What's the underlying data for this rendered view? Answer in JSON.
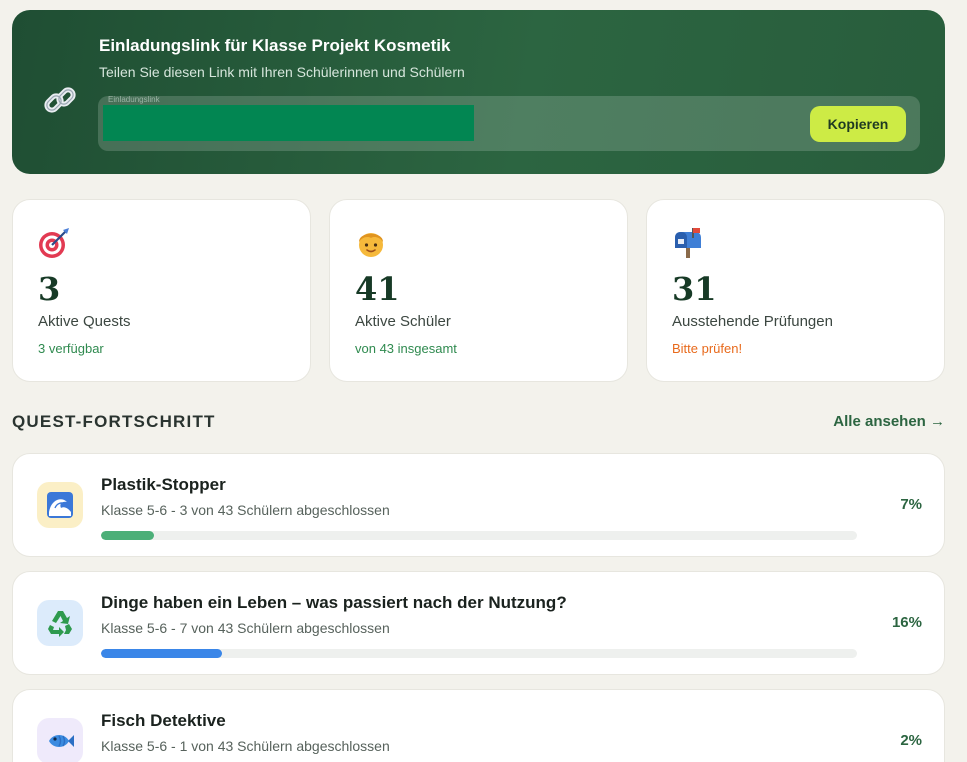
{
  "invite": {
    "title": "Einladungslink für Klasse Projekt Kosmetik",
    "subtitle": "Teilen Sie diesen Link mit Ihren Schülerinnen und Schülern",
    "field_label": "Einladungslink",
    "copy_label": "Kopieren",
    "icon": "link-icon"
  },
  "stats": [
    {
      "icon": "target-icon",
      "value": "3",
      "label": "Aktive Quests",
      "note": "3 verfügbar",
      "note_color": "#2f8a4f"
    },
    {
      "icon": "student-icon",
      "value": "41",
      "label": "Aktive Schüler",
      "note": "von 43 insgesamt",
      "note_color": "#2f8a4f"
    },
    {
      "icon": "mailbox-icon",
      "value": "31",
      "label": "Ausstehende Prüfungen",
      "note": "Bitte prüfen!",
      "note_color": "#e86a1c"
    }
  ],
  "progress_section": {
    "title": "QUEST-FORTSCHRITT",
    "see_all": "Alle ansehen →"
  },
  "quests": [
    {
      "icon": "wave-icon",
      "title": "Plastik-Stopper",
      "subtitle": "Klasse 5-6 - 3 von 43 Schülern abgeschlossen",
      "percent_label": "7%",
      "progress": 0.07,
      "bar_color": "#4caf78",
      "icon_bg": "#fbefc6"
    },
    {
      "icon": "recycle-icon",
      "title": "Dinge haben ein Leben – was passiert nach der Nutzung?",
      "subtitle": "Klasse 5-6 - 7 von 43 Schülern abgeschlossen",
      "percent_label": "16%",
      "progress": 0.16,
      "bar_color": "#3a86e8",
      "icon_bg": "#dcebfb"
    },
    {
      "icon": "fish-icon",
      "title": "Fisch Detektive",
      "subtitle": "Klasse 5-6 - 1 von 43 Schülern abgeschlossen",
      "percent_label": "2%",
      "progress": 0.02,
      "bar_color": "#8f6ad8",
      "icon_bg": "#efeafb"
    }
  ]
}
